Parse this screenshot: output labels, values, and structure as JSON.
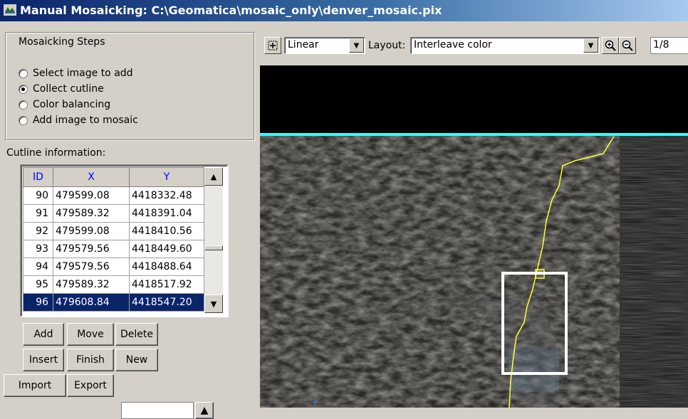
{
  "window": {
    "title": "Manual Mosaicking: C:\\Geomatica\\mosaic_only\\denver_mosaic.pix"
  },
  "steps": {
    "legend": "Mosaicking Steps",
    "options": [
      {
        "label": "Select image to add",
        "selected": false
      },
      {
        "label": "Collect cutline",
        "selected": true
      },
      {
        "label": "Color balancing",
        "selected": false
      },
      {
        "label": "Add image to mosaic",
        "selected": false
      }
    ]
  },
  "cutline": {
    "label": "Cutline information:",
    "columns": [
      "ID",
      "X",
      "Y"
    ],
    "rows": [
      [
        "90",
        "479599.08",
        "4418332.48"
      ],
      [
        "91",
        "479589.32",
        "4418391.04"
      ],
      [
        "92",
        "479599.08",
        "4418410.56"
      ],
      [
        "93",
        "479579.56",
        "4418449.60"
      ],
      [
        "94",
        "479579.56",
        "4418488.64"
      ],
      [
        "95",
        "479589.32",
        "4418517.92"
      ],
      [
        "96",
        "479608.84",
        "4418547.20"
      ]
    ],
    "selected_row": "96"
  },
  "buttons": {
    "add": "Add",
    "move": "Move",
    "delete": "Delete",
    "insert": "Insert",
    "finish": "Finish",
    "new": "New",
    "import": "Import",
    "export": "Export"
  },
  "toolbar": {
    "stretch": "Linear",
    "layout_label": "Layout:",
    "layout_value": "Interleave color",
    "zoom": "1/8"
  },
  "colors": {
    "cutline": "#ffff33",
    "boundary": "#33ffff",
    "selection": "#0a246a",
    "header_text": "#0000ff"
  },
  "icons": [
    "app-icon",
    "pan-icon",
    "zoom-in-icon",
    "zoom-out-icon",
    "scroll-up-icon",
    "scroll-down-icon",
    "dropdown-arrow-icon"
  ]
}
